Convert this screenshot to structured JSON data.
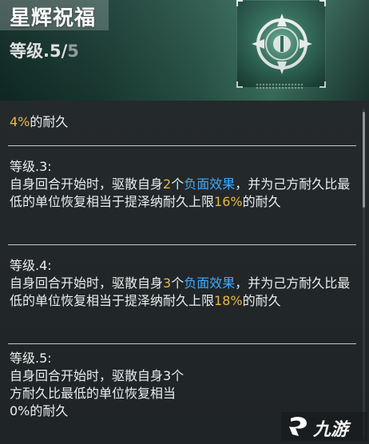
{
  "header": {
    "title": "星辉祝福",
    "level_prefix": "等级.",
    "level_current": "5",
    "level_sep": "/",
    "level_max": "5",
    "icon": "crosshair-emblem-icon"
  },
  "colors": {
    "highlight_number": "#e8b94a",
    "highlight_keyword": "#3fa9ff",
    "text": "#eceeee"
  },
  "entries": [
    {
      "tail_percent": "4%",
      "tail_text": "的耐久"
    },
    {
      "level": "等级.3:",
      "t1": "自身回合开始时，驱散自身",
      "num": "2",
      "t2": "个",
      "keyword": "负面效果",
      "t3": "，并为己方耐久比最低的单位恢复相当于提泽纳耐久上限",
      "pct1": "1",
      "pct2": "6%",
      "t4": "的耐久"
    },
    {
      "level": "等级.4:",
      "t1": "自身回合开始时，驱散自身",
      "num": "3",
      "t2": "个",
      "keyword": "负面效果",
      "t3": "，并为己方耐久比最低的单位恢复相当于提泽纳耐久上限",
      "pct1": "1",
      "pct2": "8%",
      "t4": "的耐久"
    },
    {
      "level": "等级.5:",
      "line1": "自身回合开始时，驱散自身3个",
      "line2": "方耐久比最低的单位恢复相当",
      "line3": "0%的耐久"
    }
  ],
  "watermark": {
    "logo": "jiuyou-logo-icon",
    "text": "九游"
  }
}
